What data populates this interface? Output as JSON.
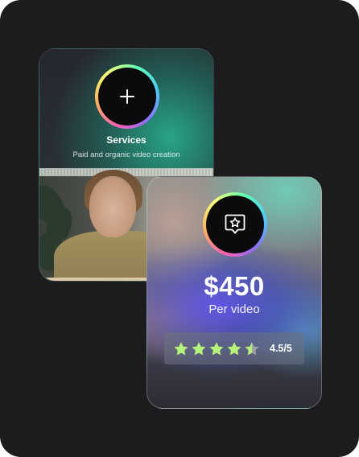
{
  "services_card": {
    "icon": "plus-icon",
    "title": "Services",
    "subtitle": "Paid and organic video creation",
    "photo": "portrait-photo"
  },
  "price_card": {
    "icon": "star-badge-icon",
    "price": "$450",
    "unit": "Per video",
    "rating": {
      "value": 4.5,
      "max": 5,
      "label": "4.5/5"
    }
  },
  "colors": {
    "background": "#1c1c1e",
    "star_filled": "#b6f37a",
    "star_empty": "#9fa3a8",
    "ring_gradient": [
      "#ff5fb2",
      "#ffb35c",
      "#f8ff7a",
      "#5dffb4",
      "#4fc7ff",
      "#8f6bff"
    ]
  }
}
